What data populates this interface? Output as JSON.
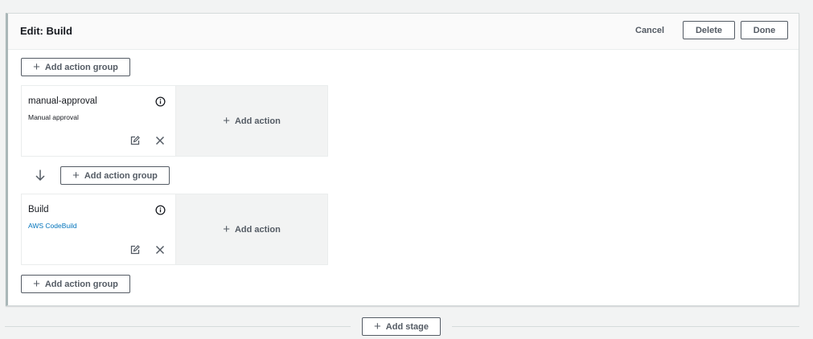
{
  "panel": {
    "title": "Edit: Build",
    "cancel_label": "Cancel",
    "delete_label": "Delete",
    "done_label": "Done"
  },
  "add_action_group_label": "Add action group",
  "add_action_label": "Add action",
  "add_stage_label": "Add stage",
  "plus_glyph": "+",
  "action_groups": [
    {
      "name": "manual-approval",
      "provider": "Manual approval"
    },
    {
      "name": "Build",
      "provider": "AWS CodeBuild"
    }
  ]
}
